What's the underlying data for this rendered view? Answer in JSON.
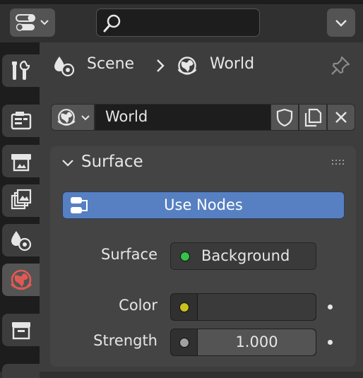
{
  "breadcrumb": {
    "scene_label": "Scene",
    "world_label": "World",
    "separator": "›"
  },
  "world_selector": {
    "value": "World"
  },
  "panel": {
    "title": "Surface"
  },
  "use_nodes": {
    "label": "Use Nodes"
  },
  "properties": {
    "surface": {
      "label": "Surface",
      "value": "Background",
      "socket_color": "#36c24a"
    },
    "color": {
      "label": "Color",
      "socket_color": "#c9c21f",
      "value": ""
    },
    "strength": {
      "label": "Strength",
      "value": "1.000",
      "socket_color": "#a1a1a1"
    }
  },
  "tabs": [
    {
      "name": "tool",
      "icon": "tool-icon"
    },
    {
      "name": "render",
      "icon": "render-icon"
    },
    {
      "name": "output",
      "icon": "output-icon"
    },
    {
      "name": "view-layer",
      "icon": "view-layer-icon"
    },
    {
      "name": "scene",
      "icon": "scene-icon"
    },
    {
      "name": "world",
      "icon": "world-icon",
      "active": true
    },
    {
      "name": "collection",
      "icon": "collection-icon"
    }
  ],
  "colors": {
    "accent": "#5680c2",
    "active_tab_icon": "#e05a55"
  }
}
